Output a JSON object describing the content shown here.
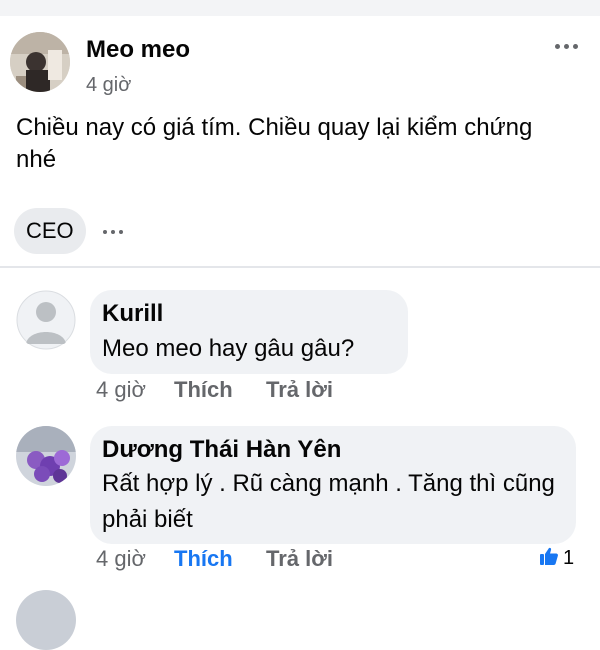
{
  "post": {
    "author": "Meo meo",
    "time": "4 giờ",
    "text": "Chiều nay có giá tím. Chiều quay lại kiểm chứng nhé",
    "tag": "CEO",
    "more_icon": "ellipsis-icon"
  },
  "comments": [
    {
      "author": "Kurill",
      "text": "Meo meo hay gâu gâu?",
      "time": "4 giờ",
      "like_label": "Thích",
      "reply_label": "Trả lời",
      "liked": false
    },
    {
      "author": "Dương Thái Hàn Yên",
      "text": "Rất hợp lý . Rũ càng mạnh . Tăng thì cũng phải biết",
      "time": "4 giờ",
      "like_label": "Thích",
      "reply_label": "Trả lời",
      "liked": true,
      "reaction_count": "1"
    }
  ],
  "colors": {
    "accent": "#1877f2",
    "secondary_text": "#65676b",
    "bubble": "#f0f2f5"
  }
}
